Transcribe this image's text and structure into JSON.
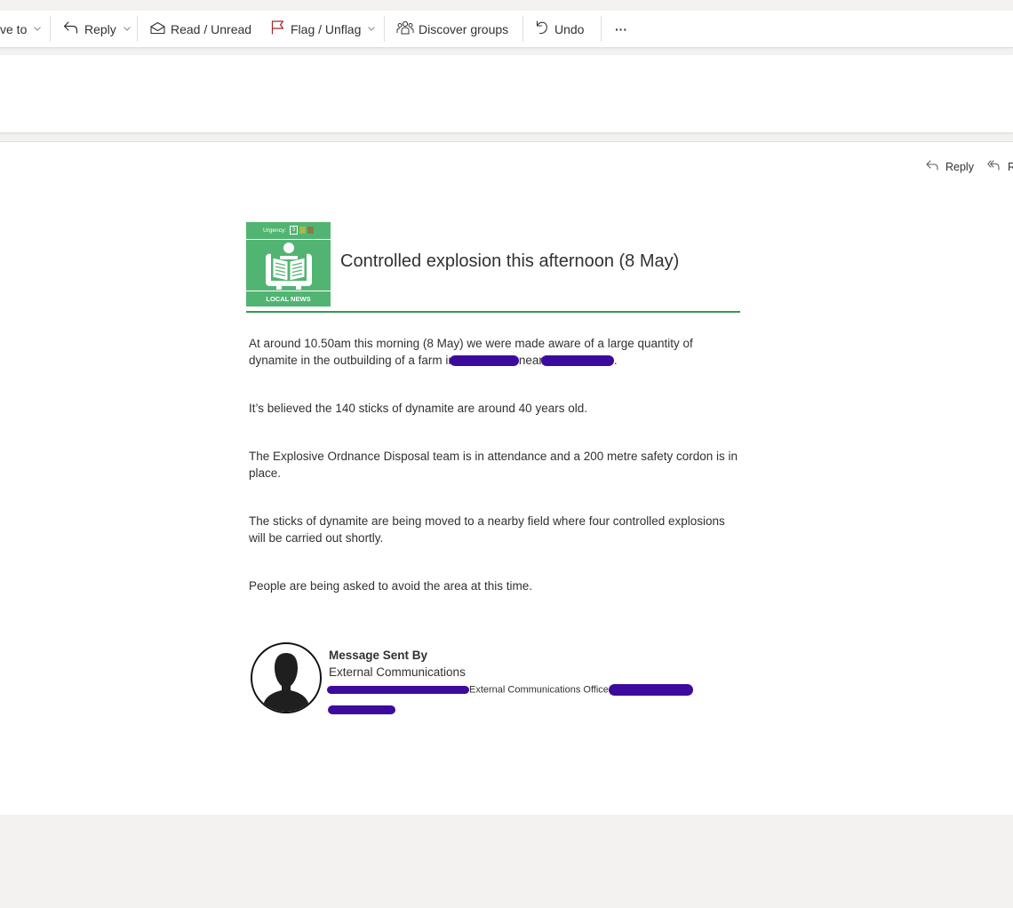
{
  "toolbar": {
    "move_to": "ve to",
    "reply": "Reply",
    "read_unread": "Read / Unread",
    "flag_unflag": "Flag / Unflag",
    "discover_groups": "Discover groups",
    "undo": "Undo",
    "more": "···"
  },
  "reading_pane": {
    "reply": "Reply",
    "reply_all": "R"
  },
  "email": {
    "logo": {
      "urgency_label": "Urgency:",
      "urgency_levels": [
        "3",
        "",
        ""
      ],
      "caption": "LOCAL NEWS"
    },
    "headline": "Controlled explosion this afternoon (8 May)",
    "paragraphs": [
      {
        "part1": "At around 10.50am this morning (8 May) we were made aware of a large quantity of dynamite in the outbuilding of a farm in",
        "part2": "near",
        "part3": "."
      },
      "It’s believed the 140 sticks of dynamite are around 40 years old.",
      "The Explosive Ordnance Disposal team is in attendance and a 200 metre safety cordon is in place.",
      "The sticks of dynamite are being moved to a nearby field where four controlled explosions will be carried out shortly.",
      "People are being asked to avoid the area at this time."
    ],
    "signature": {
      "heading": "Message Sent By",
      "department": "External Communications",
      "role": "External Communications Officer"
    }
  },
  "colors": {
    "logo_green": "#52b472",
    "rule_green": "#2e9e52",
    "redaction": "#3d0a9e",
    "flag_red": "#a4262c"
  },
  "icons": [
    "chevron-down-icon",
    "reply-icon",
    "envelope-open-icon",
    "flag-icon",
    "people-icon",
    "undo-icon",
    "more-icon",
    "reply-all-icon",
    "avatar-silhouette-icon"
  ]
}
